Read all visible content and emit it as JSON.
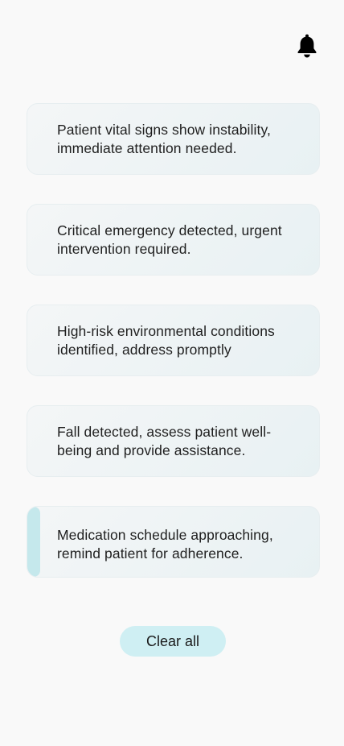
{
  "header": {
    "icon": "bell-icon"
  },
  "notifications": [
    {
      "text": "Patient vital signs show instability, immediate attention needed."
    },
    {
      "text": "Critical emergency detected, urgent intervention required."
    },
    {
      "text": "High-risk environmental conditions identified, address promptly"
    },
    {
      "text": "Fall detected, assess patient well-being and provide assistance."
    },
    {
      "text": "Medication schedule approaching, remind patient for adherence."
    }
  ],
  "actions": {
    "clear_all_label": "Clear all"
  },
  "colors": {
    "background": "#f9f9f9",
    "card_start": "#f4f6f7",
    "card_end": "#e8f1f3",
    "accent": "#c5e8ec",
    "button": "#cfeff3",
    "text": "#1f1f1f"
  }
}
